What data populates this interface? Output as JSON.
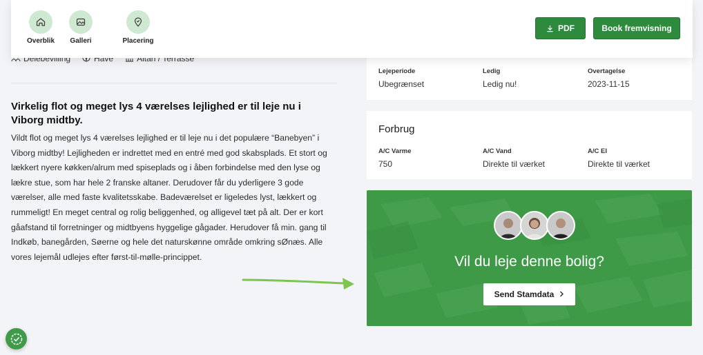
{
  "nav": {
    "items": [
      {
        "label": "Overblik",
        "icon": "home-icon"
      },
      {
        "label": "Galleri",
        "icon": "gallery-icon"
      },
      {
        "label": "Placering",
        "icon": "location-icon"
      }
    ],
    "pdf_label": "PDF",
    "book_label": "Book fremvisning"
  },
  "amenities": [
    "Delebevilling",
    "Have",
    "Altan / Terrasse"
  ],
  "listing": {
    "heading": "Virkelig flot og meget lys 4 værelses lejlighed er til leje nu i Viborg midtby.",
    "description": "Vildt flot og meget lys 4 værelses lejlighed er til leje nu i det populære “Banebyen” i Viborg midtby! Lejligheden er indrettet med en entré med god skabsplads. Et stort og lækkert nyere køkken/alrum med spiseplads og i åben forbindelse med den lyse og lækre stue, som har hele 2 franske altaner. Derudover får du yderligere 3 gode værelser, alle med faste kvalitetsskabe. Badeværelset er ligeledes lyst, lækkert og rummeligt! En meget central og rolig beliggenhed, og alligevel tæt på alt. Der er kort gåafstand til forretninger og midtbyens hyggelige gågader. Herudover få min. gang til Indkøb, banegården, Søerne og hele det naturskønne område omkring sØnæs. Alle vores lejemål udlejes efter først-til-mølle-princippet."
  },
  "terms": {
    "columns": [
      {
        "label": "Lejeperiode",
        "value": "Ubegrænset"
      },
      {
        "label": "Ledig",
        "value": "Ledig nu!"
      },
      {
        "label": "Overtagelse",
        "value": "2023-11-15"
      }
    ]
  },
  "consumption": {
    "title": "Forbrug",
    "columns": [
      {
        "label": "A/C Varme",
        "value": "750"
      },
      {
        "label": "A/C Vand",
        "value": "Direkte til værket"
      },
      {
        "label": "A/C El",
        "value": "Direkte til værket"
      }
    ]
  },
  "cta": {
    "title": "Vil du leje denne bolig?",
    "button_label": "Send Stamdata",
    "button_icon": "chevron-right-icon"
  },
  "colors": {
    "brand_green": "#2e8b3d",
    "nav_circle": "#cfe8d2",
    "cta_green": "#3f9a49",
    "annotation_arrow": "#7cc64e"
  }
}
